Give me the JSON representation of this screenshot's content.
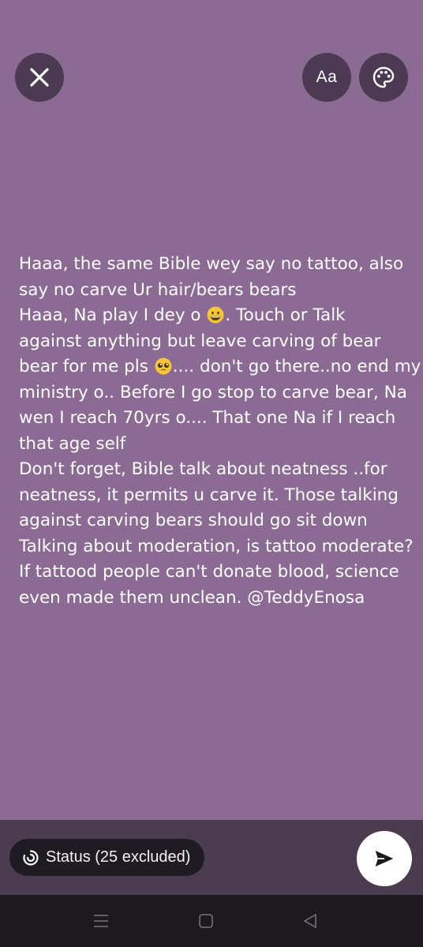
{
  "header": {
    "close_icon": "close-icon",
    "font_button_label": "Aa",
    "palette_icon": "palette-icon"
  },
  "status": {
    "lines": [
      "Haaa, the same Bible wey say no tattoo, also",
      "say no carve Ur hair/bears bears",
      "Haaa,  Na play I dey o",
      ". Touch or Talk",
      "against anything but leave carving of bear",
      "bear for me pls",
      ".... don't go there..no end my",
      "ministry o.. Before I go stop to carve bear, Na",
      "wen I reach 70yrs o.... That one Na if I reach",
      "that age self",
      "Don't forget, Bible talk about neatness ..for",
      "neatness, it permits u carve it. Those talking",
      "against carving bears should go sit down",
      "Talking about moderation, is tattoo moderate?",
      "If tattood people can't donate blood, science",
      "even made them unclean. @TeddyEnosa"
    ],
    "emojis": [
      "grinning-face-emoji",
      "pleading-face-emoji"
    ],
    "background_color": "#8b6a93",
    "text_color": "#ffffff"
  },
  "footer": {
    "audience_label": "Status (25 excluded)",
    "audience_icon": "status-ring-icon",
    "send_icon": "send-icon"
  },
  "nav": {
    "menu_icon": "recent-apps-icon",
    "home_icon": "home-icon",
    "back_icon": "back-icon"
  }
}
